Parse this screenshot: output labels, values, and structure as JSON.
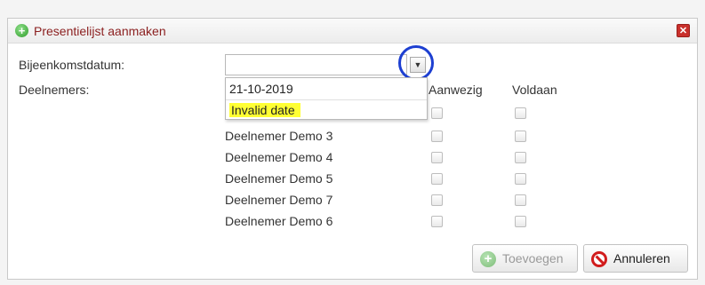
{
  "dialog": {
    "title": "Presentielijst aanmaken"
  },
  "form": {
    "date_label": "Bijeenkomstdatum:",
    "date_value": "",
    "participants_label": "Deelnemers:"
  },
  "date_dropdown": {
    "options": [
      "21-10-2019",
      "Invalid date"
    ]
  },
  "columns": {
    "present": "Aanwezig",
    "pass": "Voldaan"
  },
  "participants": [
    "Deelnemer Demo 3",
    "Deelnemer Demo 4",
    "Deelnemer Demo 5",
    "Deelnemer Demo 7",
    "Deelnemer Demo 6"
  ],
  "buttons": {
    "add": "Toevoegen",
    "cancel": "Annuleren"
  },
  "colors": {
    "title_text": "#8b1f1f",
    "highlight_ring": "#1d3fd1",
    "invalid_highlight": "#ffff33",
    "cancel_icon": "#d11c1c"
  },
  "icons": {
    "title": "plus-circle-icon",
    "close": "close-icon",
    "dropdown": "chevron-down-icon",
    "add": "plus-circle-icon",
    "cancel": "ban-icon"
  }
}
